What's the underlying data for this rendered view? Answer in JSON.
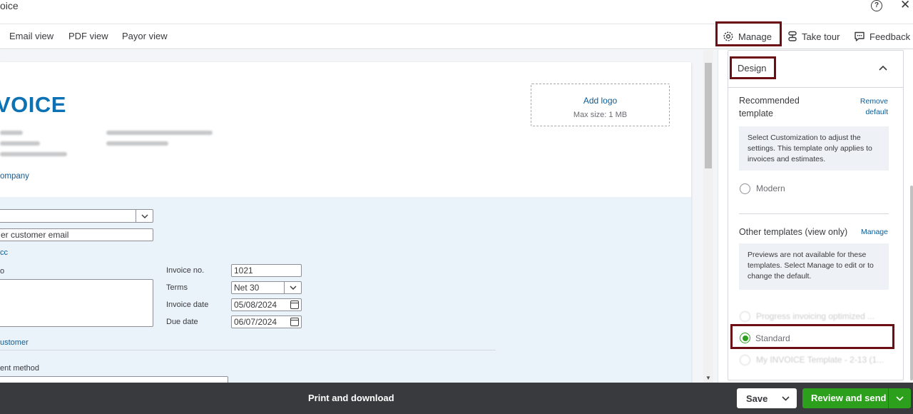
{
  "window": {
    "title": "oice"
  },
  "tabs": [
    "Email view",
    "PDF view",
    "Payor view"
  ],
  "toolbar": {
    "manage": "Manage",
    "take_tour": "Take tour",
    "feedback": "Feedback"
  },
  "invoice": {
    "heading": "VOICE",
    "company_link": "ompany",
    "add_logo": "Add logo",
    "max_size": "Max size: 1 MB",
    "customer_email_placeholder": "er customer email",
    "cc_link": "cc",
    "bill_to_label": "o",
    "customer_link": "ustomer",
    "payment_method_label": "ent method",
    "fields": {
      "invoice_no_label": "Invoice no.",
      "invoice_no": "1021",
      "terms_label": "Terms",
      "terms": "Net 30",
      "invoice_date_label": "Invoice date",
      "invoice_date": "05/08/2024",
      "due_date_label": "Due date",
      "due_date": "06/07/2024"
    }
  },
  "panel": {
    "design": "Design",
    "recommended": "Recommended template",
    "remove_default": "Remove default",
    "info1": "Select Customization to adjust the settings. This template only applies to invoices and estimates.",
    "modern": "Modern",
    "other": "Other templates (view only)",
    "manage_link": "Manage",
    "info2": "Previews are not available for these templates. Select Manage to edit or to change the default.",
    "progress": "Progress invoicing optimized ...",
    "standard": "Standard",
    "my_template": "My INVOICE Template - 2-13 (1..."
  },
  "footer": {
    "print": "Print and download",
    "save": "Save",
    "send": "Review and send"
  },
  "colors": {
    "accent": "#2ca01c",
    "highlight": "#6b0f14",
    "link": "#0d5c95",
    "heading": "#0d72b3"
  }
}
